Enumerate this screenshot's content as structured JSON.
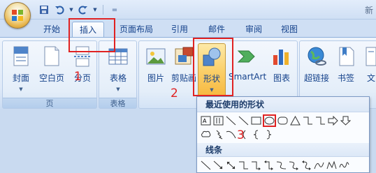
{
  "title": "新",
  "qat": [
    "save-icon",
    "undo-icon",
    "redo-icon",
    "customize-icon"
  ],
  "tabs": [
    {
      "label": "开始"
    },
    {
      "label": "插入"
    },
    {
      "label": "页面布局"
    },
    {
      "label": "引用"
    },
    {
      "label": "邮件"
    },
    {
      "label": "审阅"
    },
    {
      "label": "视图"
    }
  ],
  "groups": {
    "pages": {
      "label": "页",
      "buttons": [
        "封面",
        "空白页",
        "分页"
      ]
    },
    "tables": {
      "label": "表格",
      "buttons": [
        "表格"
      ]
    },
    "illustrations": {
      "buttons": [
        "图片",
        "剪贴画",
        "形状",
        "SmartArt",
        "图表"
      ]
    },
    "links": {
      "buttons": [
        "超链接",
        "书签",
        "文"
      ]
    }
  },
  "annotations": [
    "1",
    "2",
    "3"
  ],
  "shapes_dropdown": {
    "recent_header": "最近使用的形状",
    "lines_header": "线条"
  },
  "colors": {
    "annotation": "#e02222",
    "ribbon": "#dfeaf8",
    "text": "#15428b"
  }
}
